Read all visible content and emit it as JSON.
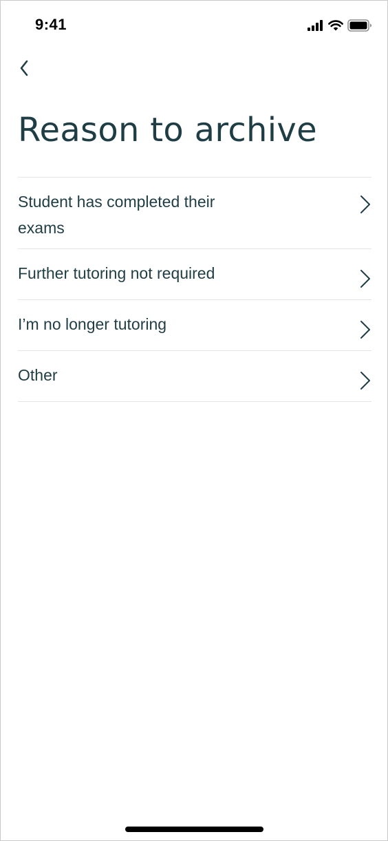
{
  "status_bar": {
    "time": "9:41",
    "icons": [
      "cellular-signal-icon",
      "wifi-icon",
      "battery-icon"
    ]
  },
  "nav": {
    "back_icon": "chevron-left-icon"
  },
  "page": {
    "title": "Reason to archive"
  },
  "options": [
    {
      "label": "Student has completed their exams",
      "icon": "chevron-right-icon"
    },
    {
      "label": "Further tutoring not required",
      "icon": "chevron-right-icon"
    },
    {
      "label": "I’m no longer tutoring",
      "icon": "chevron-right-icon"
    },
    {
      "label": "Other",
      "icon": "chevron-right-icon"
    }
  ],
  "colors": {
    "primary_text": "#1f3d44",
    "divider": "#e4e4e4",
    "background": "#ffffff"
  }
}
